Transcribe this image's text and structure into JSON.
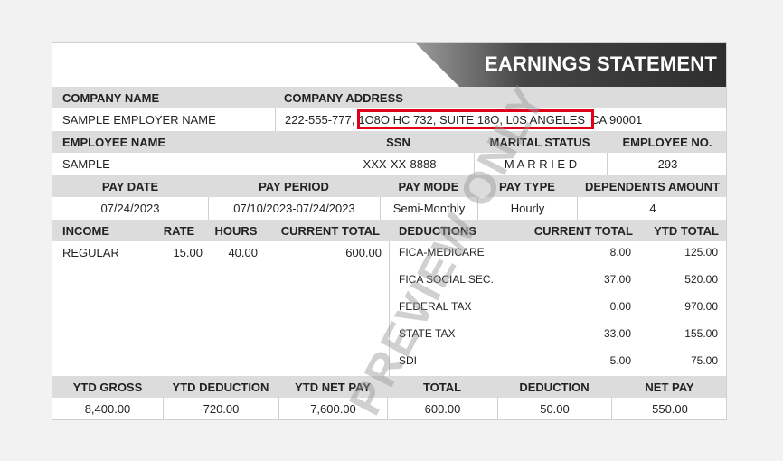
{
  "banner": {
    "title": "EARNINGS STATEMENT"
  },
  "company": {
    "name_label": "COMPANY NAME",
    "address_label": "COMPANY ADDRESS",
    "name": "SAMPLE EMPLOYER NAME",
    "phone": "222-555-777,",
    "street": "1O8O HC 732, SUITE 18O, L0S ANGELES",
    "state_zip": "CA 90001"
  },
  "employee": {
    "name_label": "EMPLOYEE NAME",
    "ssn_label": "SSN",
    "marital_label": "MARITAL STATUS",
    "no_label": "EMPLOYEE NO.",
    "name": "SAMPLE",
    "ssn": "XXX-XX-8888",
    "marital": "M A R R I E D",
    "no": "293"
  },
  "pay": {
    "date_label": "PAY DATE",
    "period_label": "PAY PERIOD",
    "mode_label": "PAY MODE",
    "type_label": "PAY TYPE",
    "dependents_label": "DEPENDENTS AMOUNT",
    "date": "07/24/2023",
    "period": "07/10/2023-07/24/2023",
    "mode": "Semi-Monthly",
    "type": "Hourly",
    "dependents": "4"
  },
  "income": {
    "income_label": "INCOME",
    "rate_label": "RATE",
    "hours_label": "HOURS",
    "current_label": "CURRENT TOTAL",
    "rows": [
      {
        "name": "REGULAR",
        "rate": "15.00",
        "hours": "40.00",
        "current": "600.00"
      }
    ]
  },
  "deductions": {
    "label": "DEDUCTIONS",
    "current_label": "CURRENT TOTAL",
    "ytd_label": "YTD TOTAL",
    "rows": [
      {
        "name": "FICA-MEDICARE",
        "current": "8.00",
        "ytd": "125.00"
      },
      {
        "name": "FICA SOCIAL SEC.",
        "current": "37.00",
        "ytd": "520.00"
      },
      {
        "name": "FEDERAL TAX",
        "current": "0.00",
        "ytd": "970.00"
      },
      {
        "name": "STATE TAX",
        "current": "33.00",
        "ytd": "155.00"
      },
      {
        "name": "SDI",
        "current": "5.00",
        "ytd": "75.00"
      }
    ]
  },
  "summary": {
    "ytd_gross_label": "YTD GROSS",
    "ytd_deduction_label": "YTD DEDUCTION",
    "ytd_net_label": "YTD NET PAY",
    "total_label": "TOTAL",
    "deduction_label": "DEDUCTION",
    "net_label": "NET PAY",
    "ytd_gross": "8,400.00",
    "ytd_deduction": "720.00",
    "ytd_net": "7,600.00",
    "total": "600.00",
    "deduction": "50.00",
    "net": "550.00"
  },
  "watermark": "PREVIEW ONLY"
}
